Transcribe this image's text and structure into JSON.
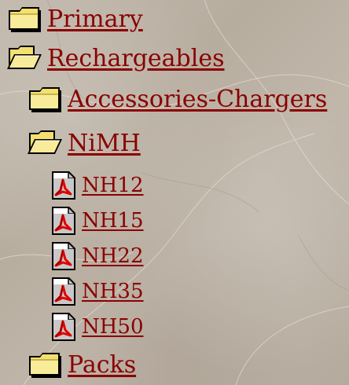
{
  "tree": {
    "primary": {
      "label": "Primary",
      "icon": "folder-closed-icon"
    },
    "rechargeables": {
      "label": "Rechargeables",
      "icon": "folder-open-icon",
      "children": {
        "accessories": {
          "label": "Accessories-Chargers",
          "icon": "folder-closed-icon"
        },
        "nimh": {
          "label": "NiMH",
          "icon": "folder-open-icon",
          "files": [
            {
              "label": "NH12",
              "icon": "pdf-document-icon"
            },
            {
              "label": "NH15",
              "icon": "pdf-document-icon"
            },
            {
              "label": "NH22",
              "icon": "pdf-document-icon"
            },
            {
              "label": "NH35",
              "icon": "pdf-document-icon"
            },
            {
              "label": "NH50",
              "icon": "pdf-document-icon"
            }
          ]
        },
        "packs": {
          "label": "Packs",
          "icon": "folder-closed-icon"
        }
      }
    }
  },
  "colors": {
    "link": "#8a0000",
    "background": "#bcb2a6",
    "folder": "#f4e070"
  }
}
